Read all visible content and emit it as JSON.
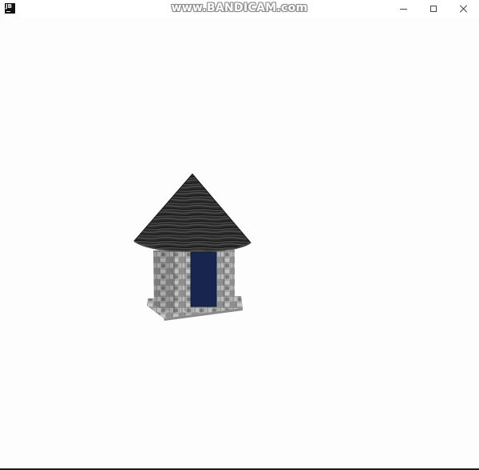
{
  "window": {
    "app_icon_label": "JB",
    "watermark": "www.BANDICAM.com",
    "controls": [
      "minimize",
      "maximize",
      "close"
    ]
  },
  "scene": {
    "object": "hut",
    "roof_color": "#2e2e2e",
    "wall_color": "#a8a8a8",
    "door_color": "#16264e",
    "base_color": "#b5b5b5",
    "background_color": "#fefdfe"
  }
}
